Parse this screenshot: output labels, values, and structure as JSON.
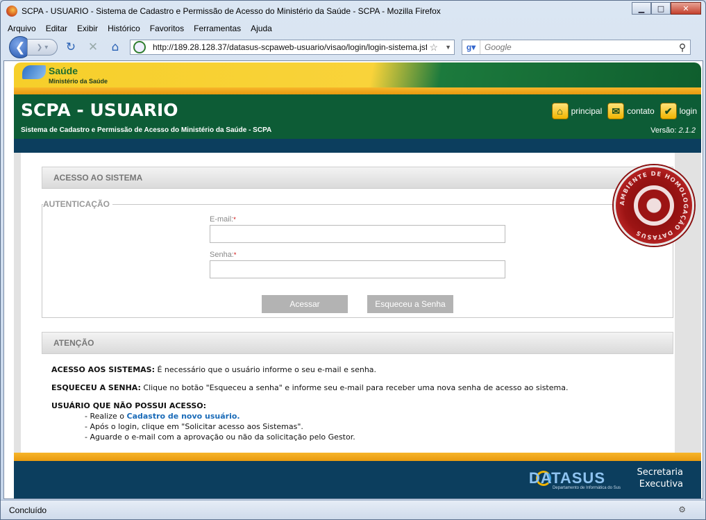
{
  "window": {
    "title": "SCPA - USUARIO - Sistema de Cadastro e Permissão de Acesso do Ministério da Saúde - SCPA - Mozilla Firefox",
    "minimize": "▁",
    "maximize": "□",
    "close": "✕"
  },
  "menu": [
    "Arquivo",
    "Editar",
    "Exibir",
    "Histórico",
    "Favoritos",
    "Ferramentas",
    "Ajuda"
  ],
  "nav": {
    "url": "http://189.28.128.37/datasus-scpaweb-usuario/visao/login/login-sistema.jsf",
    "search_placeholder": "Google"
  },
  "banner": {
    "saude": "Saúde",
    "ministerio": "Ministério da Saúde"
  },
  "header": {
    "title": "SCPA - USUARIO",
    "subtitle": "Sistema de Cadastro e Permissão de Acesso do Ministério da Saúde - SCPA",
    "version_label": "Versão:",
    "version": "2.1.2",
    "nav": [
      {
        "label": "principal",
        "icon": "home-icon"
      },
      {
        "label": "contato",
        "icon": "mail-icon"
      },
      {
        "label": "login",
        "icon": "check-icon"
      }
    ]
  },
  "access": {
    "section_title": "ACESSO AO SISTEMA",
    "legend": "AUTENTICAÇÃO",
    "email_label": "E-mail:",
    "password_label": "Senha:",
    "required_mark": "*",
    "submit": "Acessar",
    "forgot": "Esqueceu a Senha"
  },
  "stamp": {
    "text": "AMBIENTE DE HOMOLOGAÇÃO DATASUS"
  },
  "attention": {
    "section_title": "ATENÇÃO",
    "item1_title": "ACESSO AOS SISTEMAS:",
    "item1_text": " É necessário que o usuário informe o seu e-mail e senha.",
    "item2_title": "ESQUECEU A SENHA:",
    "item2_text": " Clique no botão \"Esqueceu a senha\" e informe seu e-mail para receber uma nova senha de acesso ao sistema.",
    "item3_title": "USUÁRIO QUE NÃO POSSUI ACESSO:",
    "step1_prefix": "- Realize o ",
    "step1_link": "Cadastro de novo usuário.",
    "step2": "- Após o login, clique em \"Solicitar acesso aos Sistemas\".",
    "step3": "- Aguarde o e-mail com a aprovação ou não da solicitação pelo Gestor."
  },
  "footer": {
    "datasus": "DATASUS",
    "datasus_sub": "Departamento de Informática do Sus",
    "secretaria_line1": "Secretaria",
    "secretaria_line2": "Executiva"
  },
  "status": {
    "text": "Concluído"
  }
}
